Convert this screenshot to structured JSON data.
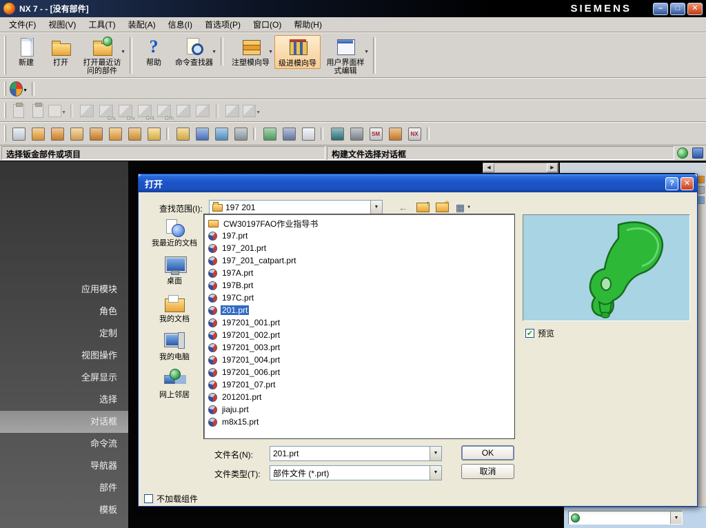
{
  "window": {
    "title": "NX 7  -  - [没有部件]",
    "brand": "SIEMENS"
  },
  "menubar": {
    "items": [
      "文件(F)",
      "视图(V)",
      "工具(T)",
      "装配(A)",
      "信息(I)",
      "首选项(P)",
      "窗口(O)",
      "帮助(H)"
    ]
  },
  "toolbar_main": {
    "items": [
      {
        "label": "新建",
        "icon": "new-part"
      },
      {
        "label": "打开",
        "icon": "open-part"
      },
      {
        "label": "打开最近访问的部件",
        "icon": "recent-parts",
        "dropdown": true,
        "sepafter": true
      },
      {
        "label": "帮助",
        "icon": "help"
      },
      {
        "label": "命令查找器",
        "icon": "command-finder",
        "dropdown": true,
        "sepafter": true
      },
      {
        "label": "注塑模向导",
        "icon": "mold-wizard",
        "dropdown": true
      },
      {
        "label": "级进模向导",
        "icon": "progressive-die-wizard",
        "selected": true
      },
      {
        "label": "用户界面样式编辑",
        "icon": "ui-styler",
        "dropdown": true,
        "sepafter": true
      }
    ]
  },
  "toolbar_roles": {
    "items": [
      {
        "icon": "roles",
        "dropdown": true,
        "sepafter": true
      }
    ]
  },
  "toolbar_assembly": {
    "items": [
      {
        "icon": "clipboard",
        "grayed": true
      },
      {
        "icon": "clipboard",
        "grayed": true
      },
      {
        "icon": "selector",
        "grayed": true,
        "dropdown": true,
        "sepafter": true
      },
      {
        "icon": "cube",
        "grayed": true
      },
      {
        "icon": "cube",
        "grayed": true,
        "label": "G/s"
      },
      {
        "icon": "cube",
        "grayed": true,
        "label": "O/s"
      },
      {
        "icon": "cube",
        "grayed": true,
        "label": "G/4"
      },
      {
        "icon": "cube",
        "grayed": true,
        "label": "O/h"
      },
      {
        "icon": "cube",
        "grayed": true
      },
      {
        "icon": "cube",
        "grayed": true,
        "sepafter": true
      },
      {
        "icon": "cube",
        "grayed": true
      },
      {
        "icon": "cube",
        "grayed": true,
        "dropdown": true
      }
    ]
  },
  "toolbar_tools": {
    "items": [
      {
        "c1": "#d8e2ea"
      },
      {
        "c1": "#f3a83b"
      },
      {
        "c1": "#e8912f"
      },
      {
        "c1": "#f0b65a"
      },
      {
        "c1": "#de8c2a"
      },
      {
        "c1": "#f3a83b"
      },
      {
        "c1": "#e8a23b"
      },
      {
        "c1": "#f5c84f",
        "sepafter": true
      },
      {
        "c1": "#f2c14e"
      },
      {
        "c1": "#4f7fd0"
      },
      {
        "c1": "#5aa0d8"
      },
      {
        "c1": "#9aa4ae",
        "sepafter": true
      },
      {
        "c1": "#57b06a"
      },
      {
        "c1": "#6f87b8"
      },
      {
        "c1": "#e9eef4",
        "sepafter": true
      },
      {
        "c1": "#2e7d88"
      },
      {
        "c1": "#8a939c"
      },
      {
        "text": "SM",
        "c1": "#dde2e7"
      },
      {
        "c1": "#e08a2c"
      },
      {
        "text": "NX",
        "c1": "#dde2e7",
        "sepafter": true
      }
    ]
  },
  "statusbar": {
    "prompt": "选择钣金部件或项目",
    "status": "构建文件选择对话框"
  },
  "sidebar": {
    "items": [
      {
        "label": "应用模块"
      },
      {
        "label": "角色"
      },
      {
        "label": "定制"
      },
      {
        "label": "视图操作"
      },
      {
        "label": "全屏显示"
      },
      {
        "label": "选择"
      },
      {
        "label": "对话框",
        "selected": true
      },
      {
        "label": "命令流"
      },
      {
        "label": "导航器"
      },
      {
        "label": "部件"
      },
      {
        "label": "模板"
      }
    ]
  },
  "open_dialog": {
    "title": "打开",
    "look_in": {
      "label": "查找范围(I):",
      "value": "197 201"
    },
    "places": [
      {
        "label": "我最近的文档",
        "icon": "recent-docs"
      },
      {
        "label": "桌面",
        "icon": "desktop"
      },
      {
        "label": "我的文档",
        "icon": "my-docs"
      },
      {
        "label": "我的电脑",
        "icon": "my-computer"
      },
      {
        "label": "网上邻居",
        "icon": "network"
      }
    ],
    "files": [
      {
        "name": "CW30197FAO作业指导书",
        "folder": true
      },
      {
        "name": "197.prt"
      },
      {
        "name": "197_201.prt"
      },
      {
        "name": "197_201_catpart.prt"
      },
      {
        "name": "197A.prt"
      },
      {
        "name": "197B.prt"
      },
      {
        "name": "197C.prt"
      },
      {
        "name": "201.prt",
        "selected": true
      },
      {
        "name": "197201_001.prt"
      },
      {
        "name": "197201_002.prt"
      },
      {
        "name": "197201_003.prt"
      },
      {
        "name": "197201_004.prt"
      },
      {
        "name": "197201_006.prt"
      },
      {
        "name": "197201_07.prt"
      },
      {
        "name": "201201.prt"
      },
      {
        "name": "jiaju.prt"
      },
      {
        "name": "m8x15.prt"
      }
    ],
    "preview": {
      "label": "预览",
      "checked": true
    },
    "file_name": {
      "label": "文件名(N):",
      "value": "201.prt"
    },
    "file_type": {
      "label": "文件类型(T):",
      "value": "部件文件 (*.prt)"
    },
    "buttons": {
      "ok": "OK",
      "cancel": "取消"
    },
    "load_option": {
      "label": "不加载组件",
      "checked": false
    }
  }
}
